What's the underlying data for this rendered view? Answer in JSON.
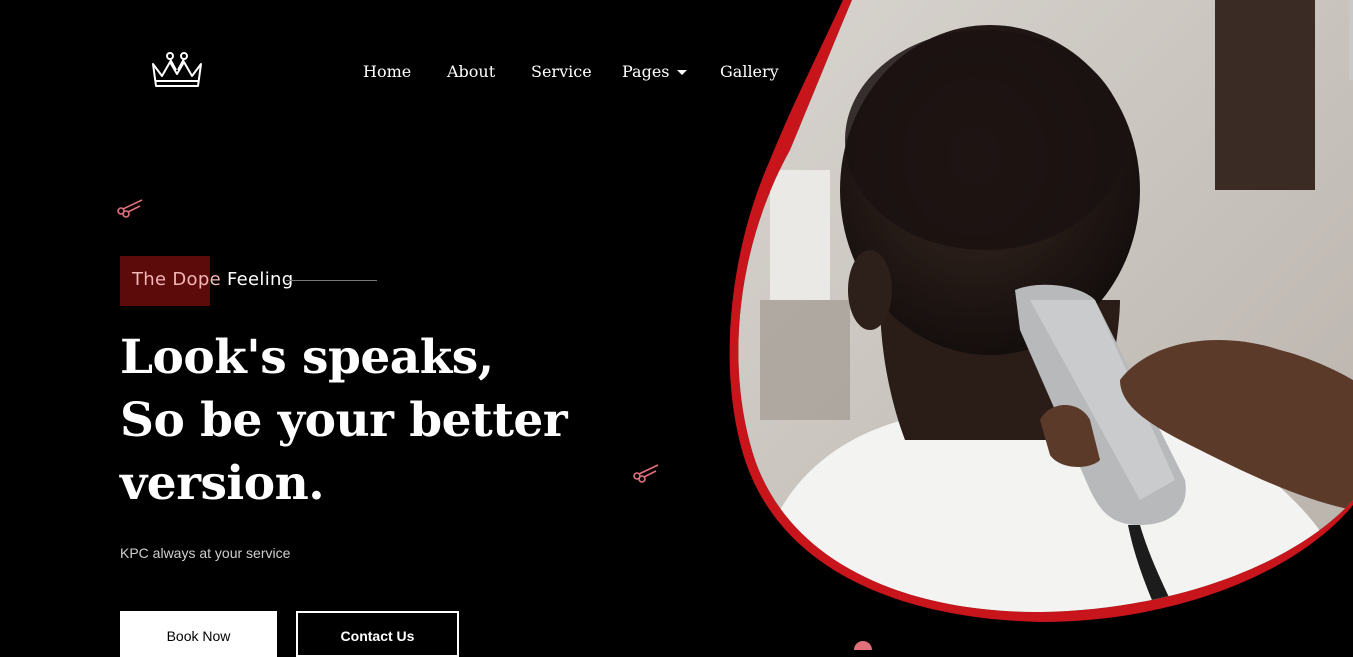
{
  "nav": {
    "items": [
      {
        "label": "Home"
      },
      {
        "label": "About"
      },
      {
        "label": "Service"
      },
      {
        "label": "Pages"
      },
      {
        "label": "Gallery"
      }
    ]
  },
  "hero": {
    "tagline_part1": "The Dope",
    "tagline_part2": " Feeling",
    "headline": [
      "Look's speaks,",
      "So be your better",
      "version."
    ],
    "subtext": "KPC always at your service",
    "book_label": "Book Now",
    "contact_label": "Contact Us"
  },
  "colors": {
    "accent": "#c8151b",
    "tag_box": "#5c0a0a",
    "background": "#000000"
  },
  "icons": [
    "crown-logo-icon",
    "scissors-icon",
    "caret-down-icon"
  ]
}
